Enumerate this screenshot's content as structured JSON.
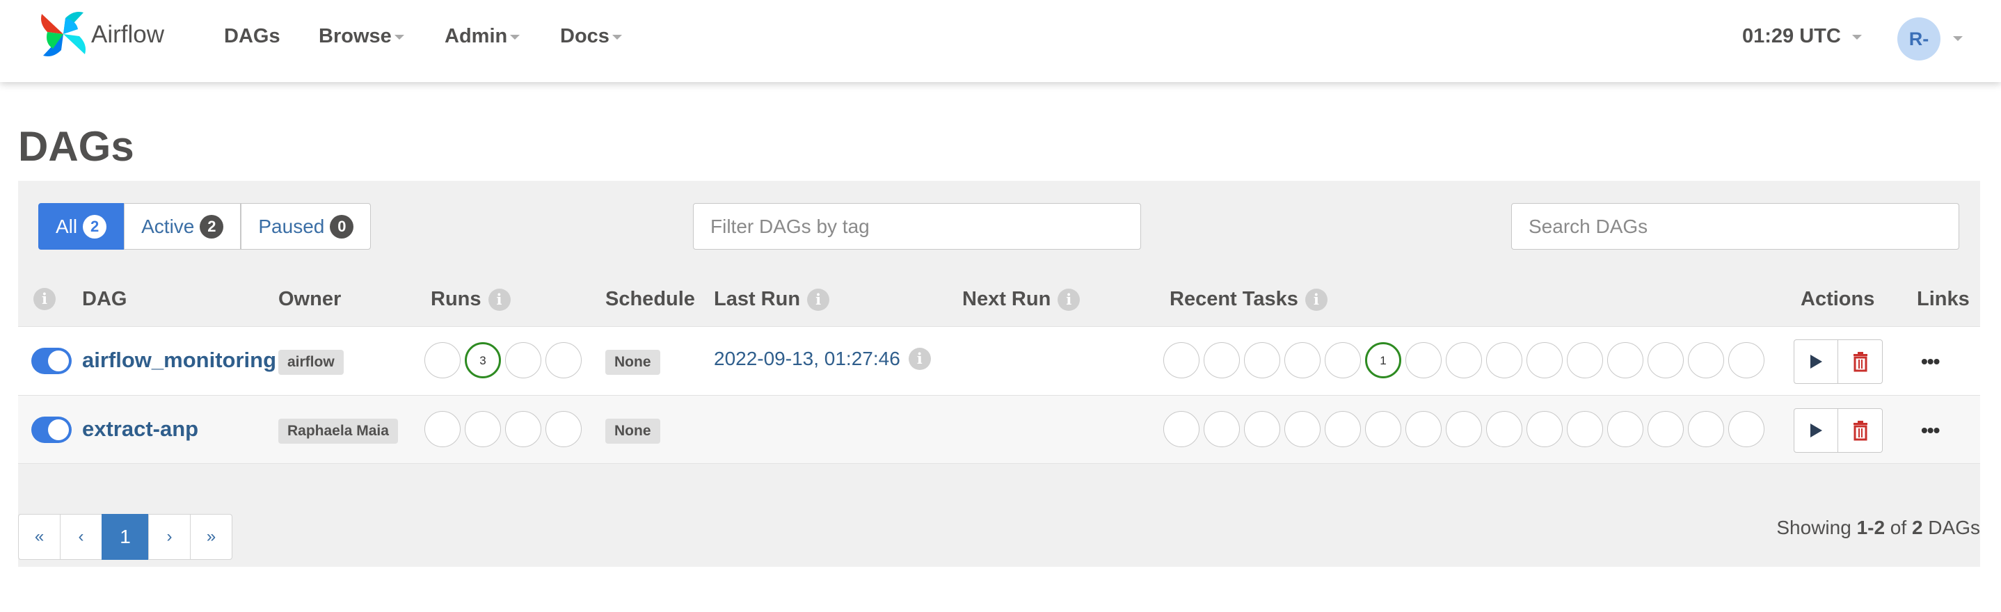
{
  "navbar": {
    "brand": "Airflow",
    "items": [
      {
        "label": "DAGs",
        "dropdown": false
      },
      {
        "label": "Browse",
        "dropdown": true
      },
      {
        "label": "Admin",
        "dropdown": true
      },
      {
        "label": "Docs",
        "dropdown": true
      }
    ],
    "clock": "01:29 UTC",
    "user_initials": "R-"
  },
  "page": {
    "title": "DAGs"
  },
  "filters": {
    "all_label": "All",
    "all_count": "2",
    "active_label": "Active",
    "active_count": "2",
    "paused_label": "Paused",
    "paused_count": "0",
    "tag_placeholder": "Filter DAGs by tag",
    "search_placeholder": "Search DAGs"
  },
  "table": {
    "columns": {
      "dag": "DAG",
      "owner": "Owner",
      "runs": "Runs",
      "schedule": "Schedule",
      "last_run": "Last Run",
      "next_run": "Next Run",
      "recent_tasks": "Recent Tasks",
      "actions": "Actions",
      "links": "Links"
    },
    "rows": [
      {
        "dag_id": "airflow_monitoring",
        "owner": "airflow",
        "schedule": "None",
        "last_run": "2022-09-13, 01:27:46",
        "next_run": "",
        "runs": [
          "",
          "3",
          "",
          ""
        ],
        "recent_tasks": [
          "",
          "",
          "",
          "",
          "",
          "1",
          "",
          "",
          "",
          "",
          "",
          "",
          "",
          "",
          ""
        ]
      },
      {
        "dag_id": "extract-anp",
        "owner": "Raphaela Maia",
        "schedule": "None",
        "last_run": "",
        "next_run": "",
        "runs": [
          "",
          "",
          "",
          ""
        ],
        "recent_tasks": [
          "",
          "",
          "",
          "",
          "",
          "",
          "",
          "",
          "",
          "",
          "",
          "",
          "",
          "",
          ""
        ]
      }
    ],
    "more_label": "•••",
    "info_glyph": "i"
  },
  "pagination": {
    "first": "«",
    "prev": "‹",
    "current": "1",
    "next": "›",
    "last": "»",
    "showing_prefix": "Showing ",
    "showing_range": "1-2",
    "showing_of": " of ",
    "showing_total": "2",
    "showing_suffix": " DAGs"
  },
  "colors": {
    "primary": "#3a7be0",
    "success": "#2e8b22",
    "danger": "#c9302c",
    "link": "#2f5e8c"
  }
}
